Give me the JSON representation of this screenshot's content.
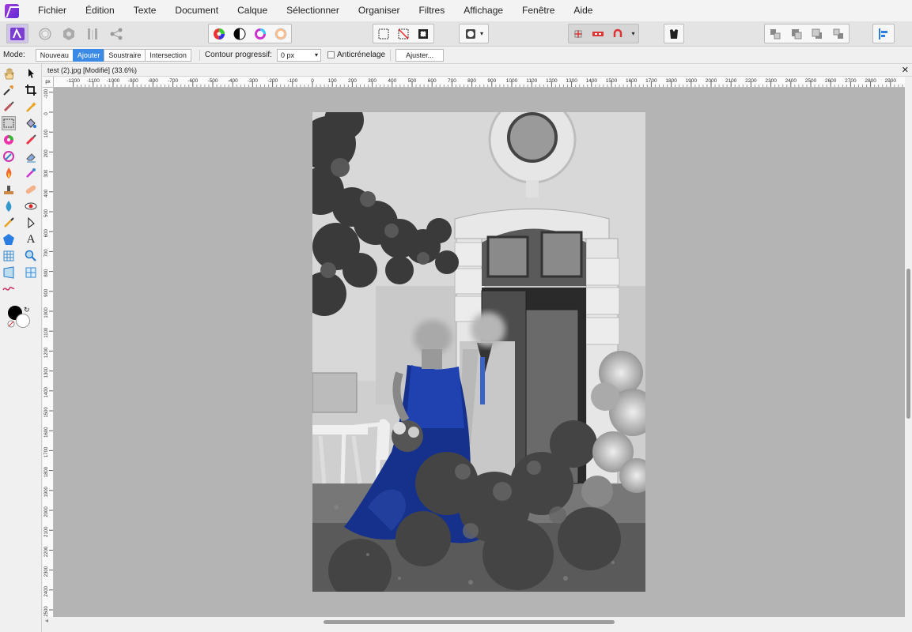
{
  "menu": [
    "Fichier",
    "Édition",
    "Texte",
    "Document",
    "Calque",
    "Sélectionner",
    "Organiser",
    "Filtres",
    "Affichage",
    "Fenêtre",
    "Aide"
  ],
  "context_bar": {
    "mode_label": "Mode:",
    "modes": [
      "Nouveau",
      "Ajouter",
      "Soustraire",
      "Intersection"
    ],
    "active_mode": "Ajouter",
    "feather_label": "Contour progressif:",
    "feather_value": "0 px",
    "antialias_label": "Anticrénelage",
    "antialias_checked": false,
    "refine_button": "Ajuster..."
  },
  "document": {
    "tab_title": "test (2).jpg [Modifié] (33.6%)",
    "close_symbol": "✕"
  },
  "rulers": {
    "unit": "px",
    "h_ticks": [
      "-1200",
      "-1100",
      "-1000",
      "-900",
      "-800",
      "-700",
      "-600",
      "-500",
      "-400",
      "-300",
      "-200",
      "-100",
      "0",
      "100",
      "200",
      "300",
      "400",
      "500",
      "600",
      "700",
      "800",
      "900",
      "1000",
      "1100",
      "1200",
      "1300",
      "1400",
      "1500",
      "1600",
      "1700",
      "1800",
      "1900",
      "2000",
      "2100",
      "2200",
      "2300",
      "2400",
      "2500",
      "2600",
      "2700",
      "2800",
      "2900"
    ],
    "v_ticks": [
      "-200",
      "-100",
      "0",
      "100",
      "200",
      "300",
      "400",
      "500",
      "600",
      "700",
      "800",
      "900",
      "1000",
      "1100",
      "1200",
      "1300",
      "1400",
      "1500",
      "1600",
      "1700",
      "1800",
      "1900",
      "2000",
      "2100",
      "2200",
      "2300",
      "2400",
      "2500"
    ]
  },
  "colors": {
    "accent": "#3b8ae6",
    "canvas_bg": "#b4b4b4",
    "dress_blue": "#15318c",
    "primary_color": "#000000",
    "secondary_color": "#ffffff"
  },
  "tool_icons": [
    "hand-icon",
    "move-icon",
    "eyedropper-icon",
    "crop-icon",
    "paintbrush-icon",
    "magic-wand-icon",
    "marquee-icon",
    "flood-fill-icon",
    "color-picker-icon",
    "paint-brush-icon",
    "selection-brush-icon",
    "eraser-icon",
    "burn-icon",
    "clone-icon",
    "stamp-icon",
    "healing-icon",
    "blur-icon",
    "red-eye-icon",
    "pen-icon",
    "node-icon",
    "shape-icon",
    "text-icon",
    "mesh-icon",
    "zoom-icon",
    "warp-icon",
    "grid-icon",
    "liquify-icon"
  ]
}
